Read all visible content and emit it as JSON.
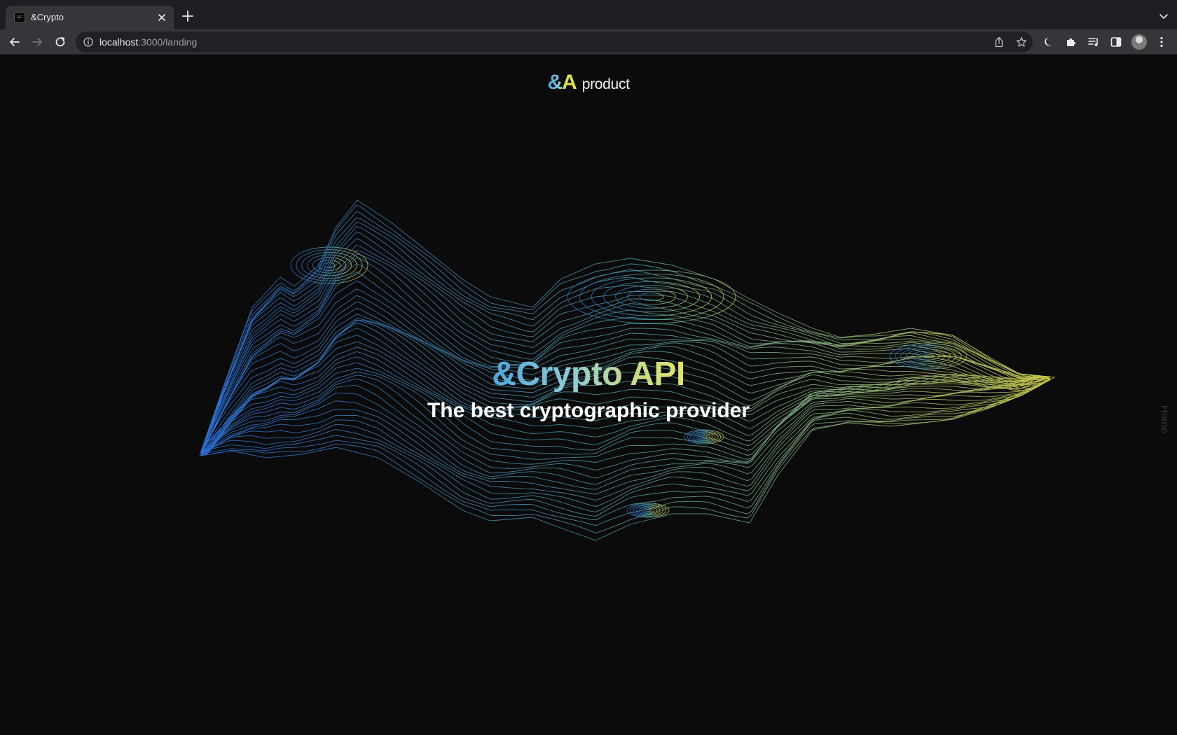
{
  "browser": {
    "tab": {
      "title": "&Crypto",
      "favicon_text": "&C"
    },
    "url": {
      "host": "localhost",
      "path": ":3000/landing"
    },
    "icons": {
      "back": "back-arrow-icon",
      "forward": "forward-arrow-icon",
      "reload": "reload-icon",
      "info": "info-icon",
      "share": "share-icon",
      "bookmark": "star-icon",
      "dark_mode": "moon-icon",
      "extensions": "puzzle-icon",
      "media": "media-queue-icon",
      "side_panel": "side-panel-icon",
      "menu": "kebab-menu-icon"
    }
  },
  "page": {
    "brand": {
      "mark": "&A",
      "text": "product"
    },
    "hero": {
      "title": "&Crypto API",
      "subtitle": "The best cryptographic provider"
    },
    "side_nav": {
      "label": "Home"
    },
    "colors": {
      "background": "#0b0b0b",
      "gradient_start": "#2a6fd6",
      "gradient_mid": "#4fa0a8",
      "gradient_end": "#c8c84a"
    }
  }
}
